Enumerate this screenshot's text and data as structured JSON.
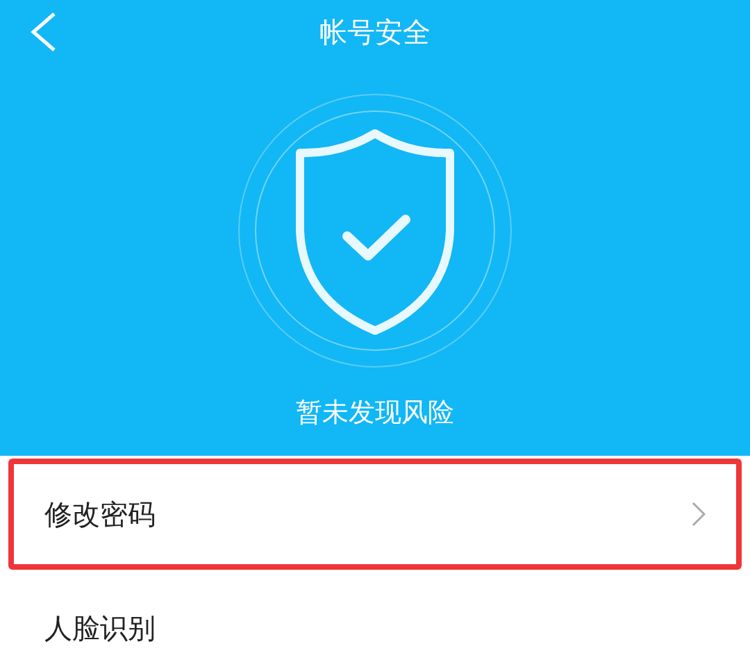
{
  "header": {
    "title": "帐号安全"
  },
  "status": {
    "text": "暂未发现风险"
  },
  "items": [
    {
      "label": "修改密码",
      "highlighted": true,
      "chevron": true
    },
    {
      "label": "人脸识别",
      "highlighted": false,
      "chevron": false
    }
  ]
}
